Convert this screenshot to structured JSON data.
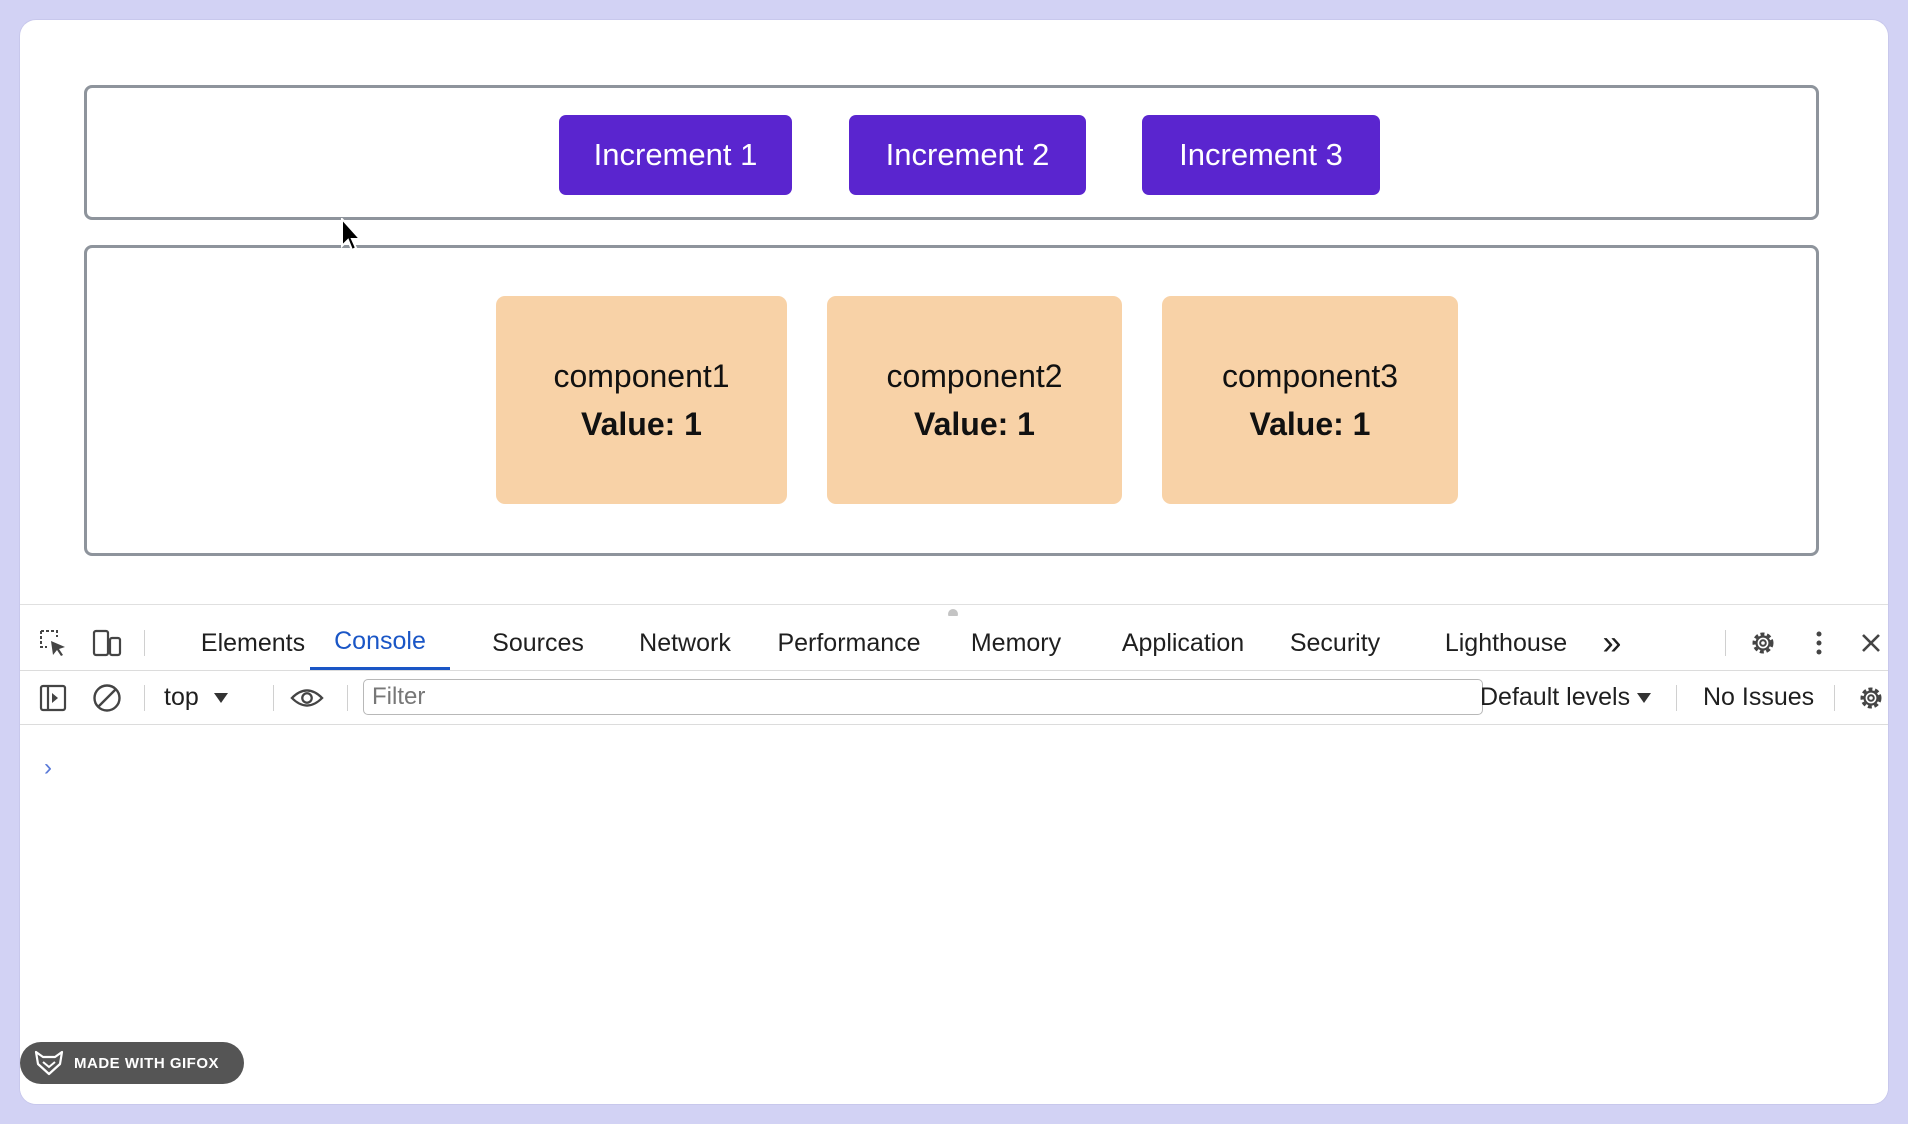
{
  "page": {
    "buttons": [
      {
        "label": "Increment 1"
      },
      {
        "label": "Increment 2"
      },
      {
        "label": "Increment 3"
      }
    ],
    "components": [
      {
        "name": "component1",
        "value": "Value: 1"
      },
      {
        "name": "component2",
        "value": "Value: 1"
      },
      {
        "name": "component3",
        "value": "Value: 1"
      }
    ],
    "colors": {
      "button": "#5a25cf",
      "card": "#f8d2a7",
      "border": "#8e949c"
    }
  },
  "devtools": {
    "tabs": [
      {
        "label": "Elements"
      },
      {
        "label": "Console"
      },
      {
        "label": "Sources"
      },
      {
        "label": "Network"
      },
      {
        "label": "Performance"
      },
      {
        "label": "Memory"
      },
      {
        "label": "Application"
      },
      {
        "label": "Security"
      },
      {
        "label": "Lighthouse"
      }
    ],
    "active_tab": "Console",
    "more_tabs_glyph": "»",
    "context_selector": "top",
    "filter": {
      "placeholder": "Filter",
      "value": ""
    },
    "levels": "Default levels",
    "issues": "No Issues",
    "prompt_glyph": "›",
    "accent": "#1a56c6"
  },
  "badge": {
    "label": "MADE WITH GIFOX"
  }
}
